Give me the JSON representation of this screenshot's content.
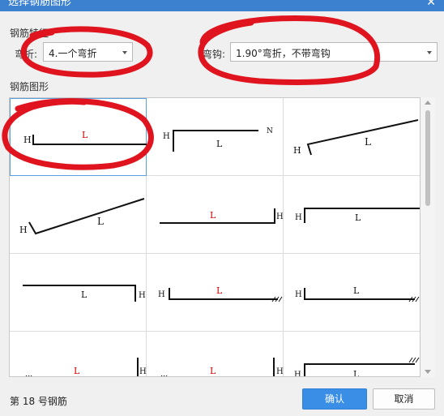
{
  "window": {
    "title": "选择钢筋图形",
    "close_glyph": "✕"
  },
  "features": {
    "section_label": "钢筋特征",
    "bend_label": "弯折:",
    "bend_value": "4.一个弯折",
    "hook_label": "弯钩:",
    "hook_value": "1.90°弯折，不带弯钩"
  },
  "shapes": {
    "section_label": "钢筋图形"
  },
  "status_text": "第 18 号钢筋",
  "buttons": {
    "ok": "确认",
    "cancel": "取消"
  },
  "colors": {
    "accent": "#3a8ee6",
    "highlight_ink": "#e0141e",
    "label_red": "#cc0000"
  }
}
